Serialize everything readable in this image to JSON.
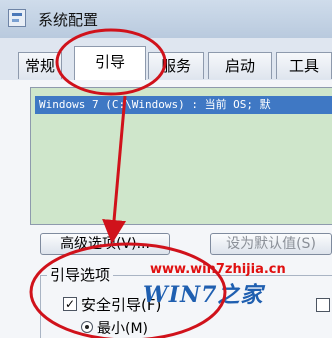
{
  "window": {
    "title": "系统配置"
  },
  "tabs": [
    {
      "label": "常规",
      "active": false
    },
    {
      "label": "引导",
      "active": true
    },
    {
      "label": "服务",
      "active": false
    },
    {
      "label": "启动",
      "active": false
    },
    {
      "label": "工具",
      "active": false
    }
  ],
  "os_list": {
    "items": [
      "Windows 7 (C:\\Windows) : 当前 OS; 默"
    ]
  },
  "buttons": {
    "advanced": "高级选项(V)...",
    "set_default": "设为默认值(S)"
  },
  "boot_options": {
    "group_label": "引导选项",
    "safe_boot_label": "安全引导(F)",
    "safe_boot_checked": true,
    "minimal_label": "最小(M)",
    "minimal_selected": true
  },
  "watermark": {
    "url": "www.win7zhijia.cn",
    "logo_text": "WIN7之家"
  },
  "colors": {
    "annotation": "#d0121b",
    "selection": "#3f78c4",
    "list_bg": "#cfe6cb"
  }
}
